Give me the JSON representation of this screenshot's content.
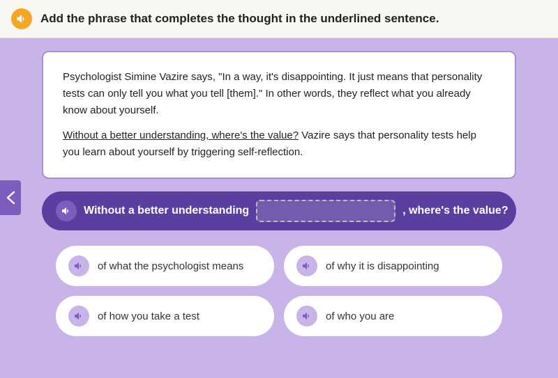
{
  "header": {
    "instruction": "Add the phrase that completes the thought in the underlined sentence."
  },
  "reading": {
    "paragraph1": "Psychologist Simine Vazire says, \"In a way, it's disappointing. It just means that personality tests can only tell you what you tell [them].\" In other words, they reflect what you already know about yourself.",
    "paragraph2_before_underline": "",
    "underlined_text": "Without a better understanding, where's the value?",
    "paragraph2_after": " Vazire says that personality tests help you learn about yourself by triggering self-reflection."
  },
  "fill_sentence": {
    "before": "Without a better understanding",
    "after": ", where's the value?"
  },
  "options": [
    {
      "id": "opt1",
      "label": "of what the psychologist means"
    },
    {
      "id": "opt2",
      "label": "of why it is disappointing"
    },
    {
      "id": "opt3",
      "label": "of how you take a test"
    },
    {
      "id": "opt4",
      "label": "of who you are"
    }
  ],
  "icons": {
    "audio": "🔊",
    "arrow_left": "❮"
  }
}
